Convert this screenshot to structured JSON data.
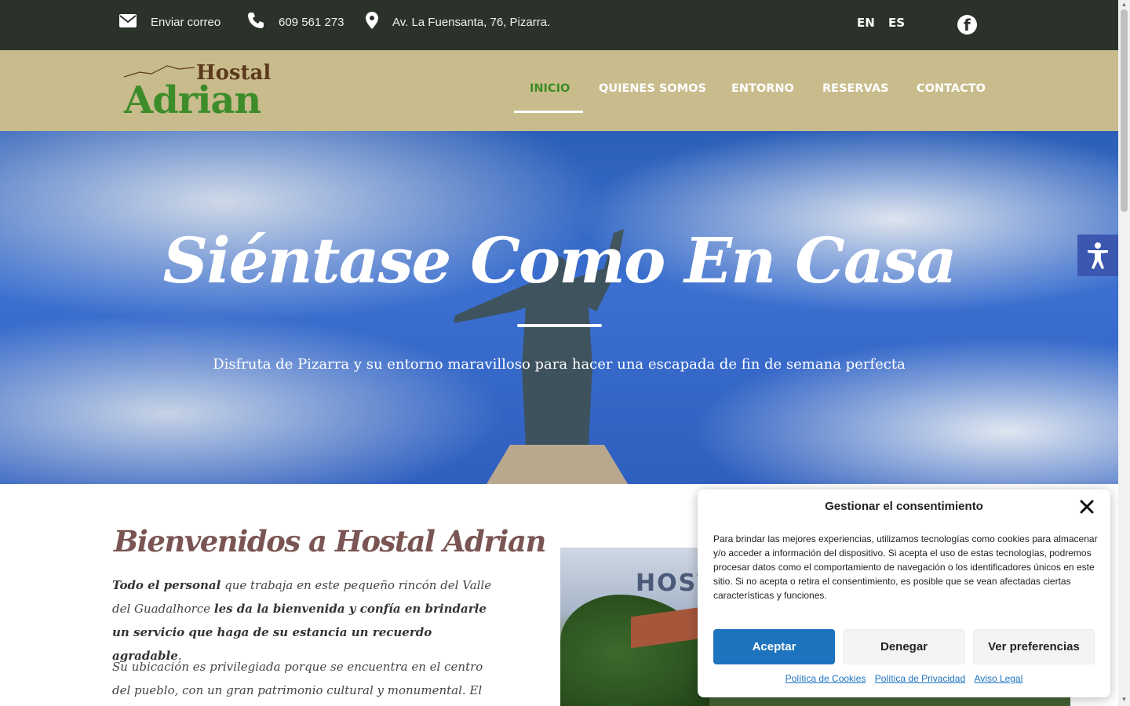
{
  "topbar": {
    "email_label": "Enviar correo",
    "phone": "609 561 273",
    "address": "Av. La Fuensanta, 76, Pizarra.",
    "lang_en": "EN",
    "lang_es": "ES",
    "facebook_glyph": "f"
  },
  "logo": {
    "line1": "Hostal",
    "line2": "Adrian"
  },
  "nav": {
    "items": [
      "INICIO",
      "QUIENES SOMOS",
      "ENTORNO",
      "RESERVAS",
      "CONTACTO"
    ],
    "active": "INICIO"
  },
  "hero": {
    "title": "Siéntase Como En Casa",
    "subtitle": "Disfruta de Pizarra y su entorno maravilloso para hacer una escapada de fin de semana perfecta"
  },
  "welcome": {
    "title": "Bienvenidos a Hostal Adrian",
    "p1_bold1": "Todo el personal",
    "p1_text1": " que trabaja en este pequeño rincón del Valle del Guadalhorce ",
    "p1_bold2": "les da la bienvenida y confía en brindarle un servicio que haga de su estancia un recuerdo agradable",
    "p1_end": ".",
    "p2": "Su ubicación es privilegiada porque se encuentra en el centro del pueblo, con un gran patrimonio cultural y monumental. El Hostal Adrian está",
    "photo_sign": "HOST"
  },
  "consent": {
    "title": "Gestionar el consentimiento",
    "body": "Para brindar las mejores experiencias, utilizamos tecnologías como cookies para almacenar y/o acceder a información del dispositivo. Si acepta el uso de estas tecnologías, podremos procesar datos como el comportamiento de navegación o los identificadores únicos en este sitio. Si no acepta o retira el consentimiento, es posible que se vean afectadas ciertas características y funciones.",
    "accept": "Aceptar",
    "deny": "Denegar",
    "preferences": "Ver preferencias",
    "links": [
      "Política de Cookies",
      "Política de Privacidad",
      "Aviso Legal"
    ]
  },
  "colors": {
    "topbar_bg": "#2b3229",
    "header_bg": "#c9bc8c",
    "nav_active": "#3c8c23",
    "accept_bg": "#1e73be",
    "a11y_bg": "#3b57b0"
  },
  "icons": [
    "envelope-icon",
    "phone-icon",
    "map-pin-icon",
    "facebook-icon",
    "accessibility-icon",
    "close-icon"
  ]
}
